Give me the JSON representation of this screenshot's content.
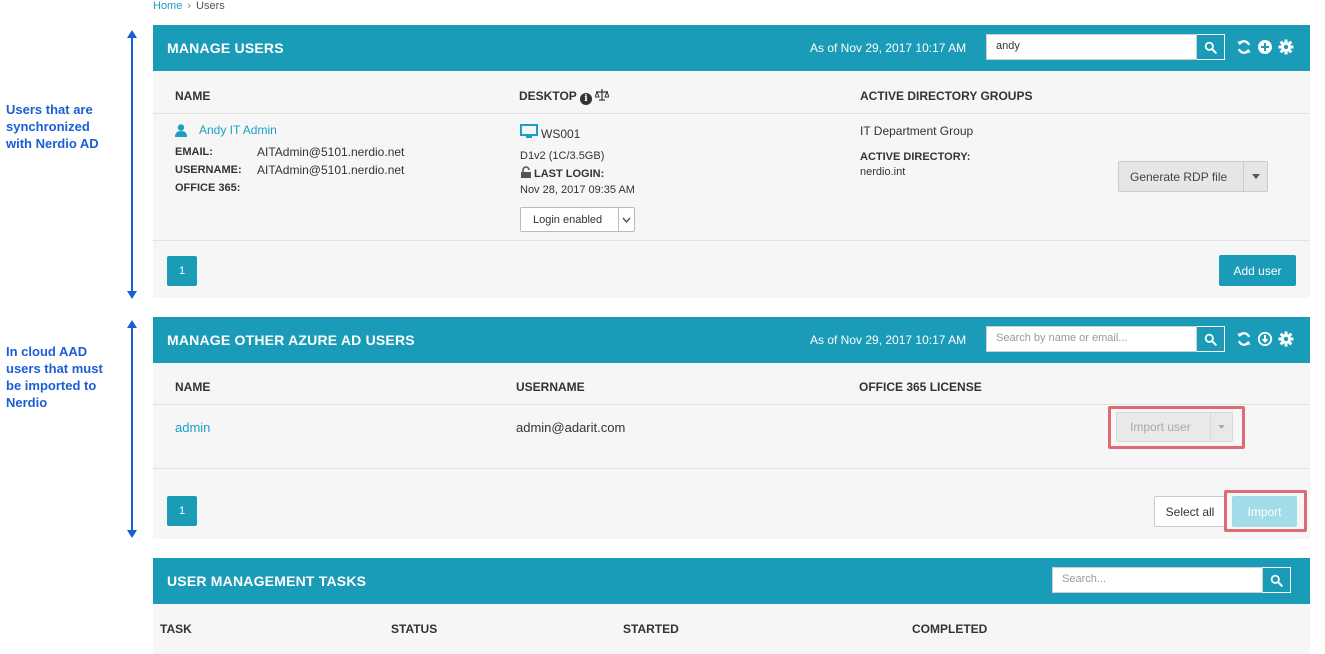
{
  "annotations": {
    "top": "Users that are synchronized with Nerdio AD",
    "bottom": "In cloud AAD users that must be imported to Nerdio"
  },
  "breadcrumb": {
    "home": "Home",
    "sep": "›",
    "current": "Users"
  },
  "manage_users": {
    "title": "MANAGE USERS",
    "as_of": "As of Nov 29, 2017 10:17 AM",
    "search_value": "andy",
    "columns": {
      "name": "NAME",
      "desktop": "DESKTOP",
      "groups": "ACTIVE DIRECTORY GROUPS"
    },
    "user": {
      "name": "Andy IT Admin",
      "email_label": "EMAIL:",
      "email": "AITAdmin@5101.nerdio.net",
      "username_label": "USERNAME:",
      "username": "AITAdmin@5101.nerdio.net",
      "office_label": "OFFICE 365:",
      "desktop_name": "WS001",
      "desktop_spec": "D1v2 (1C/3.5GB)",
      "last_login_label": "LAST LOGIN:",
      "last_login": "Nov 28, 2017 09:35 AM",
      "login_select": "Login enabled",
      "group": "IT Department Group",
      "ad_label": "ACTIVE DIRECTORY:",
      "ad_value": "nerdio.int",
      "rdp_button": "Generate RDP file"
    },
    "page": "1",
    "add_user": "Add user"
  },
  "manage_other": {
    "title": "MANAGE OTHER AZURE AD USERS",
    "as_of": "As of Nov 29, 2017 10:17 AM",
    "search_placeholder": "Search by name or email...",
    "columns": {
      "name": "NAME",
      "username": "USERNAME",
      "license": "OFFICE 365 LICENSE"
    },
    "user": {
      "name": "admin",
      "username": "admin@adarit.com",
      "import_user": "Import user"
    },
    "page": "1",
    "select_all": "Select all",
    "import": "Import"
  },
  "tasks": {
    "title": "USER MANAGEMENT TASKS",
    "search_placeholder": "Search...",
    "columns": {
      "task": "TASK",
      "status": "STATUS",
      "started": "STARTED",
      "completed": "COMPLETED"
    }
  },
  "colors": {
    "header": "#1a9cb8",
    "link": "#1aa0c4",
    "annotation": "#1a5fd6",
    "highlight": "#e06a73"
  }
}
